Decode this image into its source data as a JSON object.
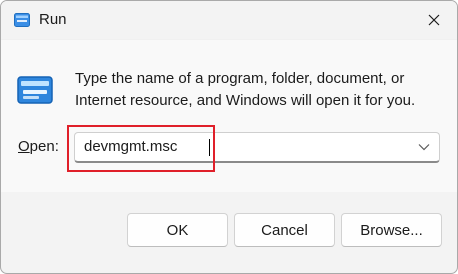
{
  "window": {
    "title": "Run",
    "close_icon": "close-icon",
    "app_icon": "run-app-icon"
  },
  "main": {
    "description_line1": "Type the name of a program, folder, document, or",
    "description_line2": "Internet resource, and Windows will open it for you.",
    "open_label_accel": "O",
    "open_label_rest": "pen:",
    "open_value": "devmgmt.msc",
    "dropdown_icon": "chevron-down-icon"
  },
  "buttons": {
    "ok": "OK",
    "cancel": "Cancel",
    "browse": "Browse..."
  },
  "colors": {
    "highlight": "#e0202a",
    "dialog_background": "#f3f3f3",
    "content_background": "#f9f9f9"
  }
}
